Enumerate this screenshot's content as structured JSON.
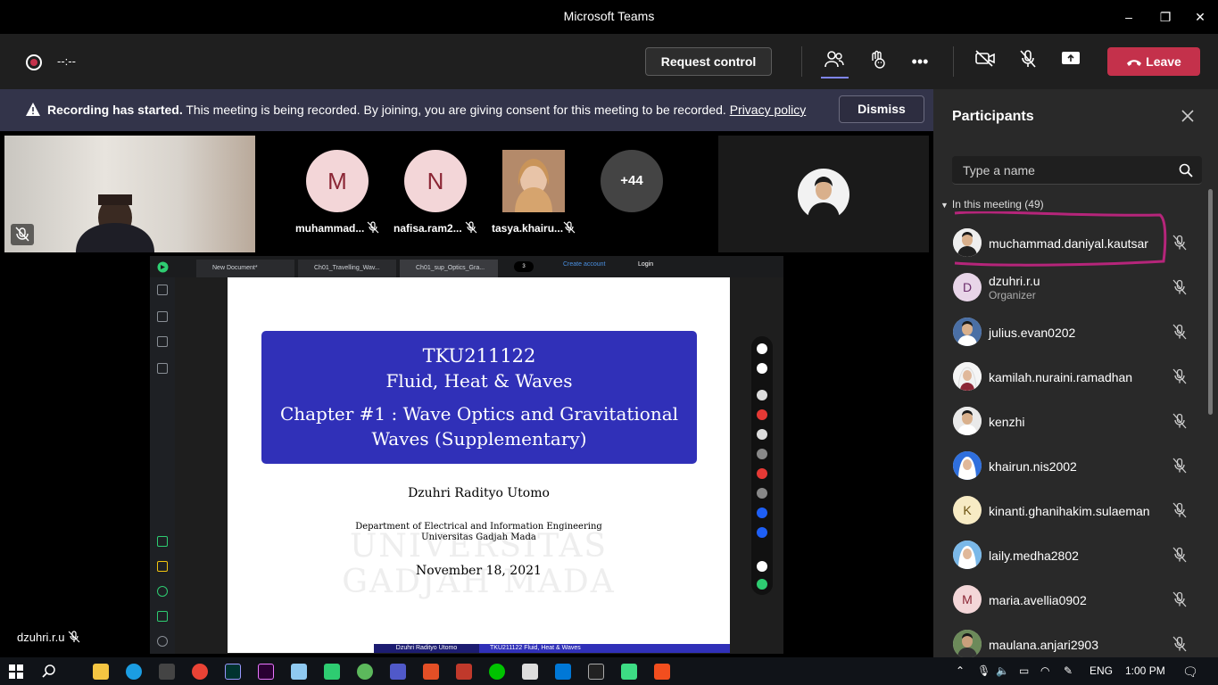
{
  "window": {
    "title": "Microsoft Teams",
    "minimize": "–",
    "maximize": "❐",
    "close": "✕"
  },
  "toolbar": {
    "timer": "--:--",
    "request_control": "Request control",
    "more": "•••",
    "leave": "Leave",
    "colors": {
      "leave": "#c4314b",
      "accent": "#7f85f5"
    }
  },
  "banner": {
    "bold": "Recording has started.",
    "text": " This meeting is being recorded. By joining, you are giving consent for this meeting to be recorded. ",
    "link": "Privacy policy",
    "dismiss": "Dismiss"
  },
  "gallery": [
    {
      "initial": "M",
      "name": "muhammad...",
      "bg": "#f3d6d8",
      "fg": "#8b2635"
    },
    {
      "initial": "N",
      "name": "nafisa.ram2...",
      "bg": "#f3d6d8",
      "fg": "#8b2635"
    },
    {
      "initial": "",
      "name": "tasya.khairu...",
      "bg": "#d9b899",
      "fg": "#333"
    },
    {
      "initial": "+44",
      "name": "",
      "bg": "#444444",
      "fg": "#ffffff"
    }
  ],
  "browser": {
    "tabs": [
      "New Document*",
      "Ch01_Travelling_Wav...",
      "Ch01_sup_Optics_Gra..."
    ],
    "tab_count": "3",
    "create_account": "Create account",
    "login": "Login"
  },
  "slide": {
    "code": "TKU211122",
    "course": "Fluid, Heat & Waves",
    "chapter": "Chapter #1 : Wave Optics and Gravitational Waves (Supplementary)",
    "author": "Dzuhri Radityo Utomo",
    "dept": "Department of Electrical and Information Engineering",
    "univ": "Universitas Gadjah Mada",
    "date": "November 18, 2021",
    "watermark1": "UNIVERSITAS",
    "watermark2": "GADJAH MADA",
    "footer_left": "Dzuhri Radityo Utomo",
    "footer_right": "TKU211122  Fluid, Heat & Waves"
  },
  "presenter": {
    "name": "dzuhri.r.u"
  },
  "panel": {
    "title": "Participants",
    "search_placeholder": "Type a name",
    "section": "In this meeting (49)",
    "participants": [
      {
        "name": "muchammad.daniyal.kautsar",
        "role": "",
        "initial": "",
        "bg": "#e8e0d8"
      },
      {
        "name": "dzuhri.r.u",
        "role": "Organizer",
        "initial": "D",
        "bg": "#e8d5e8"
      },
      {
        "name": "julius.evan0202",
        "role": "",
        "initial": "",
        "bg": "#dfe6f0"
      },
      {
        "name": "kamilah.nuraini.ramadhan",
        "role": "",
        "initial": "",
        "bg": "#f0e4e4"
      },
      {
        "name": "kenzhi",
        "role": "",
        "initial": "",
        "bg": "#e8e4dc"
      },
      {
        "name": "khairun.nis2002",
        "role": "",
        "initial": "",
        "bg": "#dde6f2"
      },
      {
        "name": "kinanti.ghanihakim.sulaeman",
        "role": "",
        "initial": "K",
        "bg": "#f7ebc4"
      },
      {
        "name": "laily.medha2802",
        "role": "",
        "initial": "",
        "bg": "#e3eef5"
      },
      {
        "name": "maria.avellia0902",
        "role": "",
        "initial": "M",
        "bg": "#f3d6d8"
      },
      {
        "name": "maulana.anjari2903",
        "role": "",
        "initial": "",
        "bg": "#d7d3c8"
      }
    ]
  },
  "taskbar": {
    "lang": "ENG",
    "time": "1:00 PM"
  }
}
